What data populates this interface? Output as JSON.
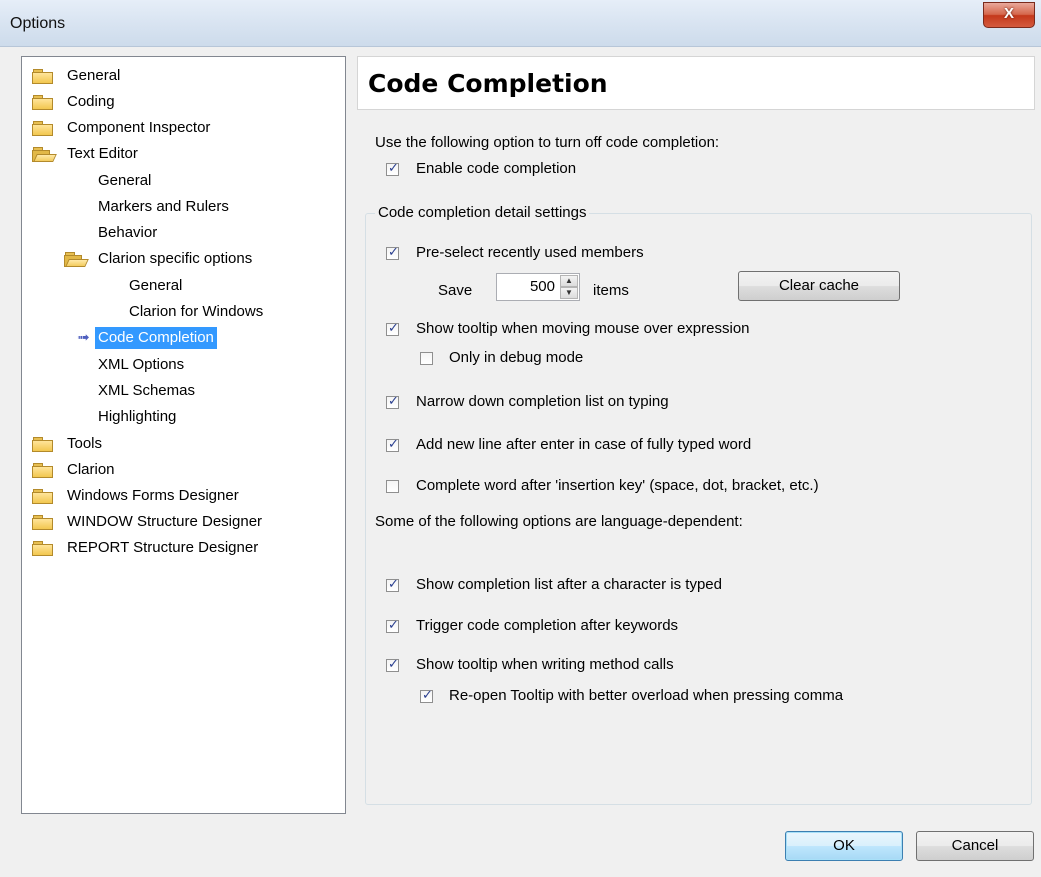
{
  "window": {
    "title": "Options",
    "close_label": "X"
  },
  "tree": {
    "items": [
      {
        "label": "General",
        "icon": "folder-closed"
      },
      {
        "label": "Coding",
        "icon": "folder-closed"
      },
      {
        "label": "Component Inspector",
        "icon": "folder-closed"
      },
      {
        "label": "Text Editor",
        "icon": "folder-open"
      },
      {
        "label": "General"
      },
      {
        "label": "Markers and Rulers"
      },
      {
        "label": "Behavior"
      },
      {
        "label": "Clarion specific options",
        "icon": "folder-open"
      },
      {
        "label": "General"
      },
      {
        "label": "Clarion for Windows"
      },
      {
        "label": "Code Completion",
        "selected": true,
        "icon": "arrow-right"
      },
      {
        "label": "XML Options"
      },
      {
        "label": "XML Schemas"
      },
      {
        "label": "Highlighting"
      },
      {
        "label": "Tools",
        "icon": "folder-closed"
      },
      {
        "label": "Clarion",
        "icon": "folder-closed"
      },
      {
        "label": "Windows Forms Designer",
        "icon": "folder-closed"
      },
      {
        "label": "WINDOW Structure Designer",
        "icon": "folder-closed"
      },
      {
        "label": "REPORT Structure Designer",
        "icon": "folder-closed"
      }
    ]
  },
  "panel": {
    "heading": "Code Completion",
    "intro": "Use the following option to turn off code completion:",
    "enable": {
      "label": "Enable code completion",
      "checked": true
    },
    "group_title": "Code completion detail settings",
    "preselect": {
      "label": "Pre-select recently used members",
      "checked": true
    },
    "save_label": "Save",
    "save_value": "500",
    "items_label": "items",
    "clear_cache": "Clear cache",
    "tooltip_mouse": {
      "label": "Show tooltip when moving mouse over expression",
      "checked": true
    },
    "debug_only": {
      "label": "Only in debug mode",
      "checked": false
    },
    "narrow": {
      "label": "Narrow down completion list on typing",
      "checked": true
    },
    "newline": {
      "label": "Add new line after enter in case of fully typed word",
      "checked": true
    },
    "complete_word": {
      "label": "Complete word after 'insertion key' (space, dot, bracket, etc.)",
      "checked": false
    },
    "lang_note": "Some of the following options are language-dependent:",
    "show_list": {
      "label": "Show completion list after a character is typed",
      "checked": true
    },
    "trigger": {
      "label": "Trigger code completion after keywords",
      "checked": true
    },
    "tooltip_calls": {
      "label": "Show tooltip when writing method calls",
      "checked": true
    },
    "reopen": {
      "label": "Re-open Tooltip with better overload when pressing comma",
      "checked": true
    }
  },
  "buttons": {
    "ok": "OK",
    "cancel": "Cancel"
  },
  "colors": {
    "selection": "#3399ff",
    "accent_close": "#c4381b"
  }
}
